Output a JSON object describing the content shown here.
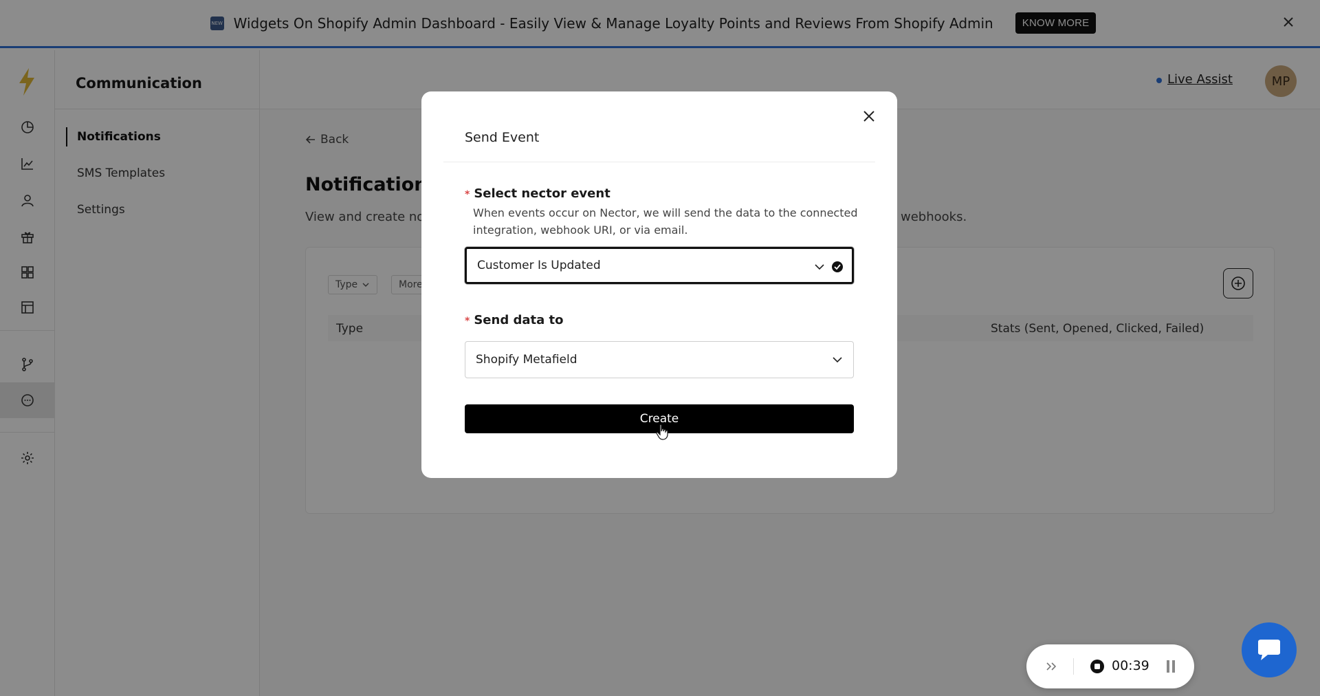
{
  "banner": {
    "icon": "new-badge-icon",
    "text": "Widgets On Shopify Admin Dashboard - Easily View & Manage Loyalty Points and Reviews From Shopify Admin",
    "button_label": "KNOW MORE"
  },
  "sidebar": {
    "icons": [
      "bolt-logo",
      "pie-chart-icon",
      "line-chart-icon",
      "user-icon",
      "gift-icon",
      "widgets-icon",
      "ledger-icon",
      "branch-icon",
      "chat-bubble-icon",
      "gear-icon"
    ],
    "active": "chat-bubble-icon"
  },
  "subnav": {
    "title": "Communication",
    "items": [
      {
        "label": "Notifications",
        "active": true
      },
      {
        "label": "SMS Templates",
        "active": false
      },
      {
        "label": "Settings",
        "active": false
      }
    ]
  },
  "header": {
    "live_assist": "Live Assist",
    "avatar_initials": "MP"
  },
  "page": {
    "back_label": "Back",
    "title": "Notifications",
    "description_left": "View and create no",
    "description_right": "webhooks.",
    "filters": [
      "Type",
      "More F"
    ],
    "columns": [
      "Type",
      "Stats (Sent, Opened, Clicked, Failed)"
    ]
  },
  "modal": {
    "title": "Send Event",
    "event_label": "Select nector event",
    "event_help": "When events occur on Nector, we will send the data to the connected integration, webhook URI, or via email.",
    "event_value": "Customer Is Updated",
    "send_label": "Send data to",
    "send_value": "Shopify Metafield",
    "create_label": "Create",
    "required_mark": "*"
  },
  "recorder": {
    "time": "00:39"
  },
  "colors": {
    "accent": "#2f6fd6",
    "chat_fab": "#1e66d0",
    "avatar": "#c8a87c",
    "required": "#d94848"
  }
}
